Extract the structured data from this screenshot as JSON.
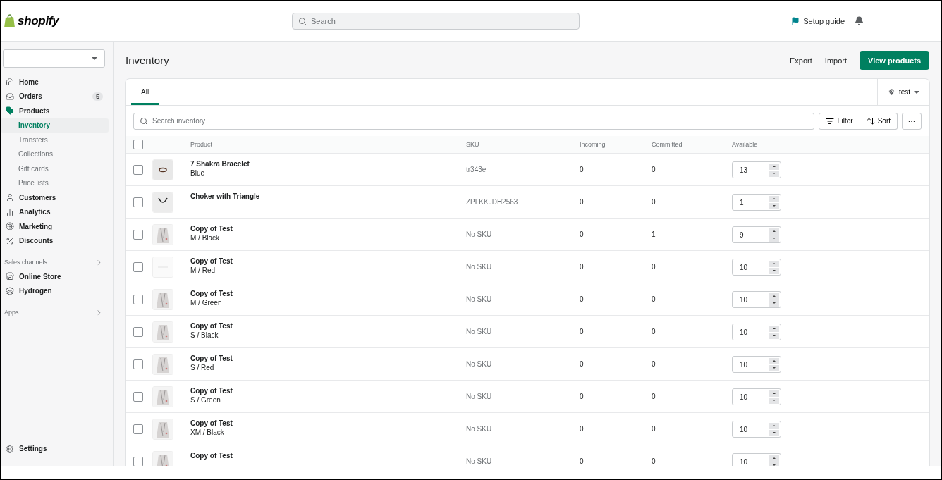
{
  "topbar": {
    "logo": "shopify",
    "search": {
      "placeholder": "Search"
    },
    "setup_guide": "Setup guide"
  },
  "sidebar": {
    "items": [
      {
        "label": "Home"
      },
      {
        "label": "Orders",
        "badge": "5"
      },
      {
        "label": "Products",
        "children": [
          {
            "label": "Inventory",
            "selected": true
          },
          {
            "label": "Transfers",
            "selected": false
          },
          {
            "label": "Collections",
            "selected": false
          },
          {
            "label": "Gift cards",
            "selected": false
          },
          {
            "label": "Price lists",
            "selected": false
          }
        ]
      },
      {
        "label": "Customers"
      },
      {
        "label": "Analytics"
      },
      {
        "label": "Marketing"
      },
      {
        "label": "Discounts"
      }
    ],
    "sales_channels": {
      "heading": "Sales channels",
      "items": [
        {
          "label": "Online Store"
        },
        {
          "label": "Hydrogen"
        }
      ]
    },
    "apps": {
      "heading": "Apps"
    },
    "settings": "Settings"
  },
  "page": {
    "title": "Inventory",
    "actions": [
      "Export",
      "Import"
    ],
    "primary_action": "View products"
  },
  "card": {
    "tabs": [
      {
        "label": "All",
        "selected": true
      }
    ],
    "location": "test",
    "search": {
      "placeholder": "Search inventory"
    },
    "filter": "Filter",
    "sort": "Sort"
  },
  "table": {
    "select_all_checked": false,
    "columns": [
      "Product",
      "SKU",
      "Incoming",
      "Committed",
      "Available"
    ],
    "rows": [
      {
        "checked": false,
        "product": "7 Shakra Bracelet",
        "variant": "Blue",
        "sku": "tr343e",
        "incoming": "0",
        "committed": "0",
        "available": "13"
      },
      {
        "checked": false,
        "product": "Choker with Triangle",
        "sku": "ZPLKKJDH2563",
        "incoming": "0",
        "committed": "0",
        "available": "1"
      },
      {
        "checked": false,
        "product": "Copy of Test",
        "variant": "M / Black",
        "sku": "No SKU",
        "incoming": "0",
        "committed": "1",
        "available": "9"
      },
      {
        "checked": false,
        "product": "Copy of Test",
        "variant": "M / Red",
        "sku": "No SKU",
        "incoming": "0",
        "committed": "0",
        "available": "10"
      },
      {
        "checked": false,
        "product": "Copy of Test",
        "variant": "M / Green",
        "sku": "No SKU",
        "incoming": "0",
        "committed": "0",
        "available": "10"
      },
      {
        "checked": false,
        "product": "Copy of Test",
        "variant": "S / Black",
        "sku": "No SKU",
        "incoming": "0",
        "committed": "0",
        "available": "10"
      },
      {
        "checked": false,
        "product": "Copy of Test",
        "variant": "S / Red",
        "sku": "No SKU",
        "incoming": "0",
        "committed": "0",
        "available": "10"
      },
      {
        "checked": false,
        "product": "Copy of Test",
        "variant": "S / Green",
        "sku": "No SKU",
        "incoming": "0",
        "committed": "0",
        "available": "10"
      },
      {
        "checked": false,
        "product": "Copy of Test",
        "variant": "XM / Black",
        "sku": "No SKU",
        "incoming": "0",
        "committed": "0",
        "available": "10"
      },
      {
        "checked": false,
        "product": "Copy of Test",
        "sku": "No SKU",
        "incoming": "0",
        "committed": "0",
        "available": "10"
      }
    ]
  }
}
